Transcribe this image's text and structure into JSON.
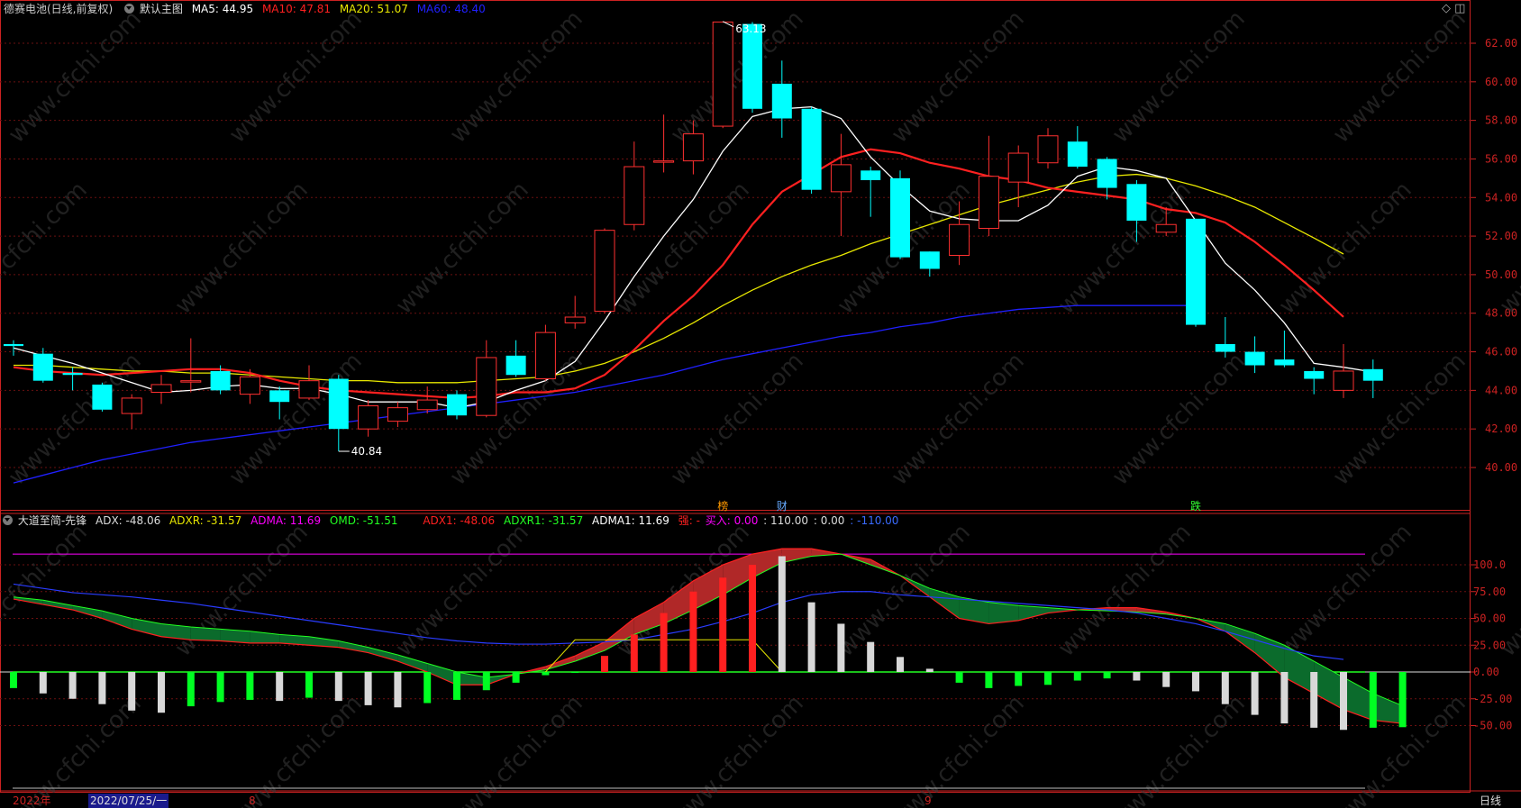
{
  "header": {
    "stock_name": "德赛电池(日线,前复权)",
    "main_chart_label": "默认主图",
    "ma5": "MA5: 44.95",
    "ma10": "MA10: 47.81",
    "ma20": "MA20: 51.07",
    "ma60": "MA60: 48.40",
    "right_icons": "◇ ◫"
  },
  "indicator": {
    "name": "大道至简-先锋",
    "adx": "ADX: -48.06",
    "adxr": "ADXR: -31.57",
    "adma": "ADMA: 11.69",
    "omd": "OMD: -51.51",
    "adx1": "ADX1: -48.06",
    "adxr1": "ADXR1: -31.57",
    "adma1": "ADMA1: 11.69",
    "strong": "强: -",
    "buy": "买入: 0.00",
    "v110": ": 110.00",
    "v0": ": 0.00",
    "vneg110": ": -110.00"
  },
  "price_axis": [
    "62.00",
    "60.00",
    "58.00",
    "56.00",
    "54.00",
    "52.00",
    "50.00",
    "48.00",
    "46.00",
    "44.00",
    "42.00",
    "40.00"
  ],
  "indicator_axis": [
    "100.0",
    "75.00",
    "50.00",
    "25.00",
    "0.00",
    "-25.00",
    "-50.00"
  ],
  "annotations": {
    "high_price": "63.13",
    "low_price": "40.84",
    "marker_bang": "榜",
    "marker_cai": "财",
    "marker_die": "跌"
  },
  "bottom_bar": {
    "year": "2022年",
    "date": "2022/07/25/一",
    "month8": "8",
    "month9": "9",
    "period": "日线"
  },
  "watermark": "www.cfchi.com",
  "colors": {
    "up": "#ff3030",
    "down": "#00ffff",
    "ma5": "#ffffff",
    "ma10": "#ff2020",
    "ma20": "#e8e800",
    "ma60": "#2020ff",
    "axis": "#cc2222"
  },
  "chart_data": {
    "type": "candlestick",
    "candles": [
      {
        "o": 46.4,
        "c": 46.3,
        "h": 46.6,
        "l": 45.8
      },
      {
        "o": 45.9,
        "c": 44.5,
        "h": 46.2,
        "l": 44.4
      },
      {
        "o": 44.9,
        "c": 44.8,
        "h": 45.2,
        "l": 44.0
      },
      {
        "o": 44.3,
        "c": 43.0,
        "h": 44.4,
        "l": 42.9
      },
      {
        "o": 42.8,
        "c": 43.6,
        "h": 43.8,
        "l": 42.0
      },
      {
        "o": 43.9,
        "c": 44.3,
        "h": 44.8,
        "l": 43.3
      },
      {
        "o": 44.5,
        "c": 44.5,
        "h": 46.7,
        "l": 43.9
      },
      {
        "o": 45.0,
        "c": 44.0,
        "h": 45.3,
        "l": 43.8
      },
      {
        "o": 43.8,
        "c": 44.7,
        "h": 45.1,
        "l": 43.3
      },
      {
        "o": 44.0,
        "c": 43.4,
        "h": 44.2,
        "l": 42.5
      },
      {
        "o": 43.6,
        "c": 44.5,
        "h": 45.3,
        "l": 43.5
      },
      {
        "o": 44.6,
        "c": 42.0,
        "h": 44.8,
        "l": 40.84
      },
      {
        "o": 42.0,
        "c": 43.2,
        "h": 43.5,
        "l": 41.6
      },
      {
        "o": 42.4,
        "c": 43.1,
        "h": 43.4,
        "l": 42.1
      },
      {
        "o": 43.0,
        "c": 43.5,
        "h": 44.2,
        "l": 42.8
      },
      {
        "o": 43.8,
        "c": 42.7,
        "h": 44.0,
        "l": 42.5
      },
      {
        "o": 42.7,
        "c": 45.7,
        "h": 46.6,
        "l": 42.6
      },
      {
        "o": 45.8,
        "c": 44.8,
        "h": 46.6,
        "l": 44.7
      },
      {
        "o": 44.6,
        "c": 47.0,
        "h": 47.4,
        "l": 44.5
      },
      {
        "o": 47.5,
        "c": 47.8,
        "h": 48.9,
        "l": 47.2
      },
      {
        "o": 48.1,
        "c": 52.3,
        "h": 52.4,
        "l": 48.0
      },
      {
        "o": 52.6,
        "c": 55.6,
        "h": 56.9,
        "l": 52.3
      },
      {
        "o": 55.9,
        "c": 55.9,
        "h": 58.3,
        "l": 55.3
      },
      {
        "o": 55.9,
        "c": 57.3,
        "h": 58.0,
        "l": 55.2
      },
      {
        "o": 57.7,
        "c": 63.1,
        "h": 63.13,
        "l": 57.6
      },
      {
        "o": 63.0,
        "c": 58.6,
        "h": 63.1,
        "l": 58.4
      },
      {
        "o": 59.9,
        "c": 58.1,
        "h": 61.1,
        "l": 57.1
      },
      {
        "o": 58.6,
        "c": 54.4,
        "h": 58.7,
        "l": 54.2
      },
      {
        "o": 54.3,
        "c": 55.7,
        "h": 57.3,
        "l": 52.0
      },
      {
        "o": 55.4,
        "c": 54.9,
        "h": 55.6,
        "l": 53.0
      },
      {
        "o": 55.0,
        "c": 50.9,
        "h": 55.4,
        "l": 50.8
      },
      {
        "o": 51.2,
        "c": 50.3,
        "h": 51.2,
        "l": 49.9
      },
      {
        "o": 51.0,
        "c": 52.6,
        "h": 53.8,
        "l": 50.5
      },
      {
        "o": 52.4,
        "c": 55.1,
        "h": 57.2,
        "l": 52.0
      },
      {
        "o": 54.8,
        "c": 56.3,
        "h": 56.7,
        "l": 53.5
      },
      {
        "o": 55.8,
        "c": 57.2,
        "h": 57.6,
        "l": 55.5
      },
      {
        "o": 56.9,
        "c": 55.6,
        "h": 57.7,
        "l": 55.5
      },
      {
        "o": 56.0,
        "c": 54.5,
        "h": 56.1,
        "l": 53.9
      },
      {
        "o": 54.7,
        "c": 52.8,
        "h": 54.9,
        "l": 51.7
      },
      {
        "o": 52.2,
        "c": 52.6,
        "h": 53.5,
        "l": 52.0
      },
      {
        "o": 52.9,
        "c": 47.4,
        "h": 52.9,
        "l": 47.3
      },
      {
        "o": 46.4,
        "c": 46.0,
        "h": 47.8,
        "l": 45.7
      },
      {
        "o": 46.0,
        "c": 45.3,
        "h": 46.8,
        "l": 44.9
      },
      {
        "o": 45.6,
        "c": 45.3,
        "h": 47.1,
        "l": 45.2
      },
      {
        "o": 45.0,
        "c": 44.6,
        "h": 45.2,
        "l": 43.8
      },
      {
        "o": 44.0,
        "c": 45.0,
        "h": 46.4,
        "l": 43.6
      },
      {
        "o": 45.1,
        "c": 44.5,
        "h": 45.6,
        "l": 43.6
      }
    ],
    "ma5": [
      46.2,
      45.8,
      45.4,
      44.9,
      44.4,
      43.9,
      44.0,
      44.2,
      44.3,
      44.1,
      44.1,
      43.8,
      43.4,
      43.4,
      43.4,
      43.1,
      43.4,
      44.0,
      44.5,
      45.5,
      47.6,
      49.9,
      52.0,
      53.9,
      56.4,
      58.2,
      58.6,
      58.7,
      58.1,
      56.1,
      54.6,
      53.3,
      52.9,
      52.8,
      52.8,
      53.6,
      55.1,
      55.6,
      55.4,
      55.0,
      52.8,
      50.6,
      49.2,
      47.5,
      45.4,
      45.2,
      44.95
    ],
    "ma10": [
      45.2,
      45.0,
      44.9,
      44.8,
      44.9,
      45.0,
      45.1,
      45.1,
      44.9,
      44.5,
      44.2,
      44.0,
      43.9,
      43.8,
      43.7,
      43.6,
      43.7,
      43.9,
      43.9,
      44.1,
      44.8,
      46.1,
      47.6,
      48.9,
      50.5,
      52.6,
      54.3,
      55.2,
      56.1,
      56.5,
      56.3,
      55.8,
      55.5,
      55.1,
      54.9,
      54.5,
      54.3,
      54.1,
      53.9,
      53.4,
      53.2,
      52.7,
      51.7,
      50.5,
      49.2,
      47.81
    ],
    "ma20": [
      45.3,
      45.3,
      45.2,
      45.1,
      45.0,
      45.0,
      44.9,
      44.9,
      44.8,
      44.7,
      44.6,
      44.5,
      44.5,
      44.4,
      44.4,
      44.4,
      44.5,
      44.6,
      44.7,
      45.0,
      45.4,
      46.0,
      46.7,
      47.5,
      48.4,
      49.2,
      49.9,
      50.5,
      51.0,
      51.6,
      52.1,
      52.6,
      53.1,
      53.6,
      54.0,
      54.4,
      54.8,
      55.1,
      55.2,
      55.0,
      54.6,
      54.1,
      53.5,
      52.7,
      51.9,
      51.07
    ],
    "ma60": [
      39.2,
      39.6,
      40.0,
      40.4,
      40.7,
      41.0,
      41.3,
      41.5,
      41.7,
      41.9,
      42.1,
      42.3,
      42.5,
      42.7,
      42.9,
      43.1,
      43.3,
      43.5,
      43.7,
      43.9,
      44.2,
      44.5,
      44.8,
      45.2,
      45.6,
      45.9,
      46.2,
      46.5,
      46.8,
      47.0,
      47.3,
      47.5,
      47.8,
      48.0,
      48.2,
      48.3,
      48.4,
      48.4,
      48.4,
      48.4,
      48.4
    ],
    "indicator_bars": [
      -15,
      -20,
      -25,
      -30,
      -36,
      -38,
      -32,
      -28,
      -26,
      -27,
      -24,
      -27,
      -31,
      -33,
      -29,
      -26,
      -17,
      -10,
      -3,
      0,
      15,
      35,
      55,
      75,
      88,
      100,
      108,
      65,
      45,
      28,
      14,
      3,
      -10,
      -15,
      -13,
      -12,
      -8,
      -6,
      -8,
      -14,
      -18,
      -30,
      -40,
      -48,
      -52,
      -54,
      -52,
      -51.5
    ],
    "adx": [
      68,
      63,
      58,
      50,
      40,
      33,
      30,
      29,
      27,
      27,
      25,
      23,
      18,
      10,
      0,
      -12,
      -12,
      -2,
      5,
      15,
      28,
      50,
      65,
      85,
      100,
      110,
      115,
      115,
      110,
      105,
      90,
      70,
      50,
      45,
      48,
      55,
      58,
      60,
      60,
      56,
      50,
      38,
      18,
      -5,
      -20,
      -35,
      -45,
      -48.06
    ],
    "adxr": [
      70,
      67,
      62,
      57,
      50,
      45,
      42,
      40,
      38,
      35,
      33,
      29,
      23,
      16,
      8,
      0,
      -5,
      -2,
      2,
      10,
      20,
      35,
      45,
      58,
      72,
      88,
      102,
      108,
      110,
      100,
      90,
      78,
      70,
      65,
      62,
      60,
      58,
      57,
      56,
      54,
      50,
      45,
      36,
      25,
      10,
      -5,
      -20,
      -31.57
    ],
    "adma": [
      82,
      78,
      74,
      72,
      70,
      67,
      64,
      60,
      56,
      52,
      48,
      44,
      40,
      36,
      32,
      29,
      27,
      26,
      26,
      27,
      28,
      30,
      35,
      40,
      47,
      55,
      65,
      72,
      75,
      75,
      72,
      70,
      68,
      66,
      64,
      62,
      60,
      58,
      55,
      50,
      45,
      38,
      30,
      22,
      15,
      11.69
    ],
    "level_110": 110
  }
}
